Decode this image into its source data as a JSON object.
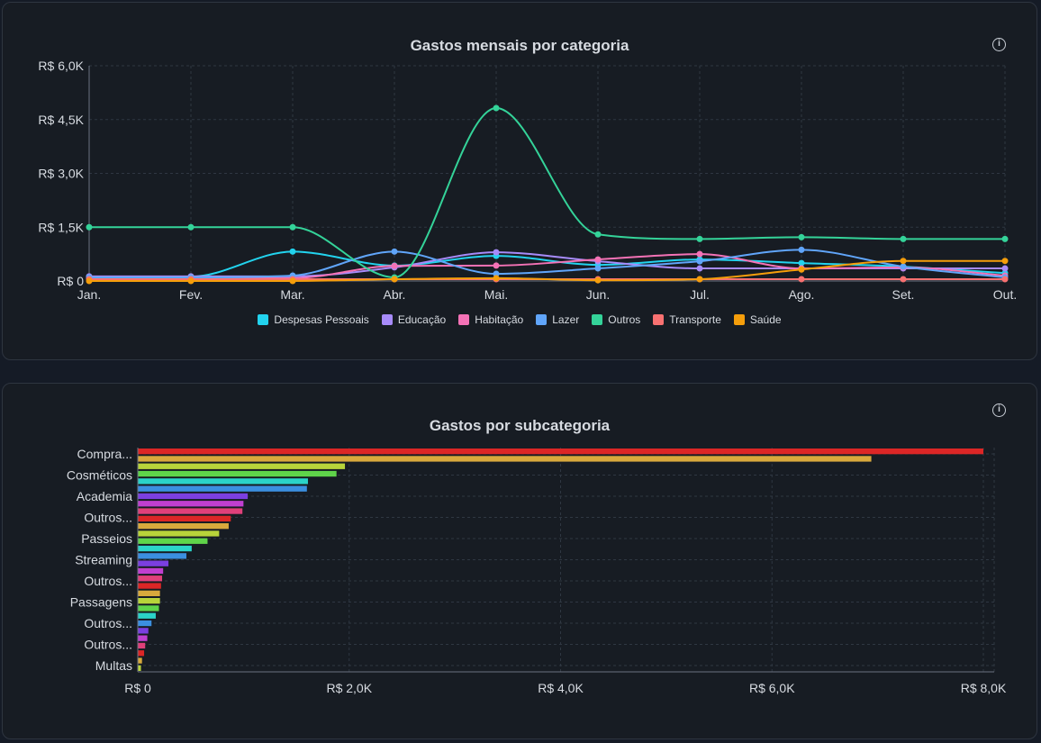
{
  "charts": {
    "line": {
      "title": "Gastos mensais por categoria",
      "info_icon": "info-icon"
    },
    "bar": {
      "title": "Gastos por subcategoria",
      "info_icon": "info-icon"
    }
  },
  "chart_data": [
    {
      "type": "line",
      "title": "Gastos mensais por categoria",
      "categories": [
        "Jan.",
        "Fev.",
        "Mar.",
        "Abr.",
        "Mai.",
        "Jun.",
        "Jul.",
        "Ago.",
        "Set.",
        "Out."
      ],
      "ylim": [
        0,
        6000
      ],
      "yticks": [
        0,
        1500,
        3000,
        4500,
        6000
      ],
      "ytick_labels": [
        "R$ 0",
        "R$ 1,5K",
        "R$ 3,0K",
        "R$ 4,5K",
        "R$ 6,0K"
      ],
      "grid": true,
      "legend_position": "bottom",
      "series": [
        {
          "name": "Despesas Pessoais",
          "color": "#22d3ee",
          "values": [
            120,
            120,
            820,
            430,
            700,
            450,
            600,
            500,
            400,
            220
          ]
        },
        {
          "name": "Educação",
          "color": "#a78bfa",
          "values": [
            130,
            130,
            130,
            380,
            800,
            550,
            350,
            350,
            350,
            350
          ]
        },
        {
          "name": "Habitação",
          "color": "#f472b6",
          "values": [
            80,
            80,
            80,
            420,
            430,
            600,
            750,
            350,
            380,
            150
          ]
        },
        {
          "name": "Lazer",
          "color": "#60a5fa",
          "values": [
            100,
            100,
            150,
            820,
            200,
            350,
            550,
            870,
            400,
            100
          ]
        },
        {
          "name": "Outros",
          "color": "#34d399",
          "values": [
            1500,
            1500,
            1500,
            100,
            4820,
            1300,
            1170,
            1220,
            1170,
            1170
          ]
        },
        {
          "name": "Transporte",
          "color": "#f87171",
          "values": [
            50,
            50,
            50,
            50,
            50,
            50,
            50,
            50,
            50,
            50
          ]
        },
        {
          "name": "Saúde",
          "color": "#f59e0b",
          "values": [
            0,
            0,
            0,
            50,
            80,
            20,
            50,
            320,
            560,
            560
          ]
        }
      ]
    },
    {
      "type": "bar",
      "orientation": "horizontal",
      "title": "Gastos por subcategoria",
      "xlim": [
        0,
        8000
      ],
      "xticks": [
        0,
        2000,
        4000,
        6000,
        8000
      ],
      "xtick_labels": [
        "R$ 0",
        "R$ 2,0K",
        "R$ 4,0K",
        "R$ 6,0K",
        "R$ 8,0K"
      ],
      "grid": true,
      "visible_category_labels": [
        "Compra...",
        "Cosméticos",
        "Academia",
        "Outros...",
        "Passeios",
        "Streaming",
        "Outros...",
        "Passagens",
        "Outros...",
        "Outros...",
        "Multas"
      ],
      "values": [
        8000,
        6940,
        1960,
        1880,
        1610,
        1600,
        1040,
        1000,
        990,
        880,
        860,
        770,
        660,
        510,
        460,
        290,
        240,
        230,
        220,
        210,
        210,
        200,
        170,
        130,
        100,
        90,
        70,
        60,
        40,
        30
      ],
      "colors": [
        "#dc2626",
        "#d8a93c",
        "#b8d43a",
        "#5fd44a",
        "#2bd3c8",
        "#3b8fe0",
        "#7b3fe0",
        "#c03fd0",
        "#e0407a",
        "#dc2626",
        "#d8a93c",
        "#b8d43a",
        "#5fd44a",
        "#2bd3c8",
        "#3b8fe0",
        "#7b3fe0",
        "#c03fd0",
        "#e0407a",
        "#dc2626",
        "#d8a93c",
        "#b8d43a",
        "#5fd44a",
        "#2bd3c8",
        "#3b8fe0",
        "#7b3fe0",
        "#c03fd0",
        "#e0407a",
        "#dc2626",
        "#d8a93c",
        "#b8d43a"
      ]
    }
  ]
}
